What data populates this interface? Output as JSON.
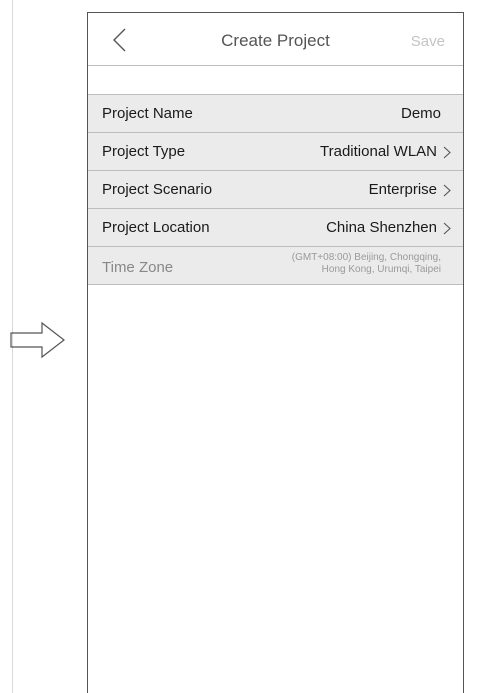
{
  "nav": {
    "title": "Create Project",
    "save": "Save"
  },
  "rows": [
    {
      "label": "Project Name",
      "value": "Demo"
    },
    {
      "label": "Project Type",
      "value": "Traditional WLAN"
    },
    {
      "label": "Project Scenario",
      "value": "Enterprise"
    },
    {
      "label": "Project Location",
      "value": "China Shenzhen"
    }
  ],
  "timezone": {
    "label": "Time Zone",
    "line1": "(GMT+08:00) Beijing, Chongqing,",
    "line2": "Hong Kong, Urumqi, Taipei"
  }
}
